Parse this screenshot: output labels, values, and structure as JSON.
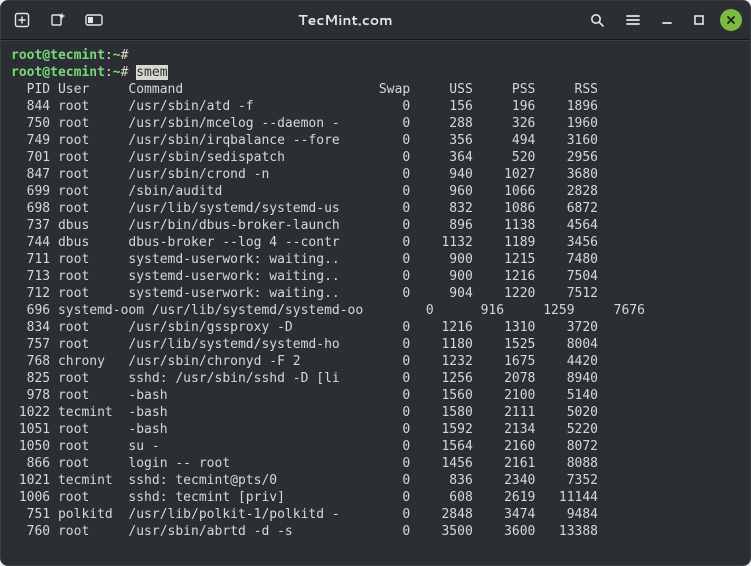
{
  "window": {
    "title": "TecMint.com"
  },
  "prompt": {
    "user_host": "root@tecmint",
    "cwd": "~",
    "sigil": "#",
    "command": "smem"
  },
  "columns": [
    "PID",
    "User",
    "Command",
    "Swap",
    "USS",
    "PSS",
    "RSS"
  ],
  "rows": [
    {
      "pid": 844,
      "user": "root",
      "cmd": "/usr/sbin/atd -f",
      "swap": 0,
      "uss": 156,
      "pss": 196,
      "rss": 1896
    },
    {
      "pid": 750,
      "user": "root",
      "cmd": "/usr/sbin/mcelog --daemon -",
      "swap": 0,
      "uss": 288,
      "pss": 326,
      "rss": 1960
    },
    {
      "pid": 749,
      "user": "root",
      "cmd": "/usr/sbin/irqbalance --fore",
      "swap": 0,
      "uss": 356,
      "pss": 494,
      "rss": 3160
    },
    {
      "pid": 701,
      "user": "root",
      "cmd": "/usr/sbin/sedispatch",
      "swap": 0,
      "uss": 364,
      "pss": 520,
      "rss": 2956
    },
    {
      "pid": 847,
      "user": "root",
      "cmd": "/usr/sbin/crond -n",
      "swap": 0,
      "uss": 940,
      "pss": 1027,
      "rss": 3680
    },
    {
      "pid": 699,
      "user": "root",
      "cmd": "/sbin/auditd",
      "swap": 0,
      "uss": 960,
      "pss": 1066,
      "rss": 2828
    },
    {
      "pid": 698,
      "user": "root",
      "cmd": "/usr/lib/systemd/systemd-us",
      "swap": 0,
      "uss": 832,
      "pss": 1086,
      "rss": 6872
    },
    {
      "pid": 737,
      "user": "dbus",
      "cmd": "/usr/bin/dbus-broker-launch",
      "swap": 0,
      "uss": 896,
      "pss": 1138,
      "rss": 4564
    },
    {
      "pid": 744,
      "user": "dbus",
      "cmd": "dbus-broker --log 4 --contr",
      "swap": 0,
      "uss": 1132,
      "pss": 1189,
      "rss": 3456
    },
    {
      "pid": 711,
      "user": "root",
      "cmd": "systemd-userwork: waiting..",
      "swap": 0,
      "uss": 900,
      "pss": 1215,
      "rss": 7480
    },
    {
      "pid": 713,
      "user": "root",
      "cmd": "systemd-userwork: waiting..",
      "swap": 0,
      "uss": 900,
      "pss": 1216,
      "rss": 7504
    },
    {
      "pid": 712,
      "user": "root",
      "cmd": "systemd-userwork: waiting..",
      "swap": 0,
      "uss": 904,
      "pss": 1220,
      "rss": 7512
    },
    {
      "pid": 696,
      "user": "systemd-oom",
      "cmd": "/usr/lib/systemd/systemd-oo",
      "swap": 0,
      "uss": 916,
      "pss": 1259,
      "rss": 7676,
      "wide": true
    },
    {
      "pid": 834,
      "user": "root",
      "cmd": "/usr/sbin/gssproxy -D",
      "swap": 0,
      "uss": 1216,
      "pss": 1310,
      "rss": 3720
    },
    {
      "pid": 757,
      "user": "root",
      "cmd": "/usr/lib/systemd/systemd-ho",
      "swap": 0,
      "uss": 1180,
      "pss": 1525,
      "rss": 8004
    },
    {
      "pid": 768,
      "user": "chrony",
      "cmd": "/usr/sbin/chronyd -F 2",
      "swap": 0,
      "uss": 1232,
      "pss": 1675,
      "rss": 4420
    },
    {
      "pid": 825,
      "user": "root",
      "cmd": "sshd: /usr/sbin/sshd -D [li",
      "swap": 0,
      "uss": 1256,
      "pss": 2078,
      "rss": 8940
    },
    {
      "pid": 978,
      "user": "root",
      "cmd": "-bash",
      "swap": 0,
      "uss": 1560,
      "pss": 2100,
      "rss": 5140
    },
    {
      "pid": 1022,
      "user": "tecmint",
      "cmd": "-bash",
      "swap": 0,
      "uss": 1580,
      "pss": 2111,
      "rss": 5020
    },
    {
      "pid": 1051,
      "user": "root",
      "cmd": "-bash",
      "swap": 0,
      "uss": 1592,
      "pss": 2134,
      "rss": 5220
    },
    {
      "pid": 1050,
      "user": "root",
      "cmd": "su -",
      "swap": 0,
      "uss": 1564,
      "pss": 2160,
      "rss": 8072
    },
    {
      "pid": 866,
      "user": "root",
      "cmd": "login -- root",
      "swap": 0,
      "uss": 1456,
      "pss": 2161,
      "rss": 8088
    },
    {
      "pid": 1021,
      "user": "tecmint",
      "cmd": "sshd: tecmint@pts/0",
      "swap": 0,
      "uss": 836,
      "pss": 2340,
      "rss": 7352
    },
    {
      "pid": 1006,
      "user": "root",
      "cmd": "sshd: tecmint [priv]",
      "swap": 0,
      "uss": 608,
      "pss": 2619,
      "rss": 11144
    },
    {
      "pid": 751,
      "user": "polkitd",
      "cmd": "/usr/lib/polkit-1/polkitd -",
      "swap": 0,
      "uss": 2848,
      "pss": 3474,
      "rss": 9484
    },
    {
      "pid": 760,
      "user": "root",
      "cmd": "/usr/sbin/abrtd -d -s",
      "swap": 0,
      "uss": 3500,
      "pss": 3600,
      "rss": 13388
    }
  ]
}
